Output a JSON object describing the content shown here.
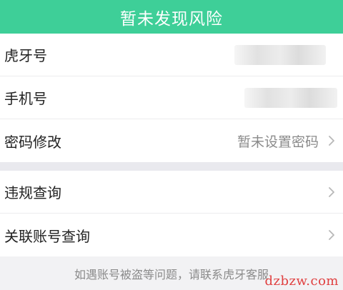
{
  "banner": {
    "title": "暂未发现风险"
  },
  "account_group": {
    "rows": [
      {
        "label": "虎牙号",
        "value": ""
      },
      {
        "label": "手机号",
        "value": ""
      },
      {
        "label": "密码修改",
        "value": "暂未设置密码"
      }
    ]
  },
  "query_group": {
    "rows": [
      {
        "label": "违规查询"
      },
      {
        "label": "关联账号查询"
      }
    ]
  },
  "footer": {
    "text": "如遇账号被盗等问题，请联系虎牙客服"
  },
  "watermark": {
    "text": "dzbzw.com"
  },
  "colors": {
    "accent": "#3ecf98",
    "watermark": "#e04040"
  }
}
